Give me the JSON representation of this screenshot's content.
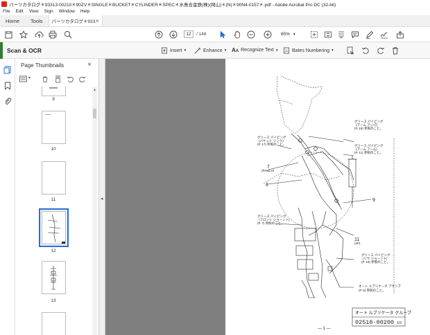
{
  "window": {
    "title": "パーツカタログ＊93313-00210＊90ZV＊SINGLE＊BUCKET＊CYLINDER＊SPEC＊水島合金鉄(株)(岡山)＊(N)＊90N4-0157＊.pdf - Adobe Acrobat Pro DC (32-bit)"
  },
  "menu": [
    "File",
    "Edit",
    "View",
    "Sign",
    "Window",
    "Help"
  ],
  "tabs": {
    "home": "Home",
    "tools": "Tools",
    "document": "パーツカタログ＊93313-...",
    "close": "×"
  },
  "toolbar": {
    "page_current": "12",
    "page_total": "/ 148",
    "zoom": "65%",
    "zoom_caret": "▾"
  },
  "scan_ocr": {
    "title": "Scan & OCR",
    "insert": "Insert",
    "enhance": "Enhance",
    "recognize": "Recognize Text",
    "bates": "Bates Numbering",
    "caret": "▾"
  },
  "thumbnails_panel": {
    "title": "Page Thumbnails",
    "close": "×",
    "collapse": "◂",
    "options_caret": "▾",
    "pages": [
      {
        "label": "9",
        "selected": false
      },
      {
        "label": "10",
        "selected": false
      },
      {
        "label": "11",
        "selected": false
      },
      {
        "label": "12",
        "selected": true
      },
      {
        "label": "13",
        "selected": false
      }
    ]
  },
  "drawing": {
    "callouts": {
      "grease_top_right_1": "グリース パイピング",
      "grease_top_right_2": "(ブーム アッパ)",
      "grease_top_right_3": "(P. 15) 参照のこと。",
      "grease_left_1": "グリース パイピング",
      "grease_left_2": "(バケット リンク)",
      "grease_left_3": "(P. 17) 参照のこと。",
      "grease_mid_right_1": "グリース パイピング",
      "grease_mid_right_2": "(ブーム アーム)",
      "grease_mid_right_3": "(P. 11) 参照のこと。",
      "grease_lower_left_1": "グリース パイピング",
      "grease_lower_left_2": "(フロント ジョーント)",
      "grease_lower_left_3": "(P. 7) 参照のこと。",
      "grease_lower_right_1": "グリース パイピング",
      "grease_lower_right_2": "(リヤ ジョーント)",
      "grease_lower_right_3": "(P. 19) 参照のこと。",
      "auto_lub_1": "オート ルブリケータ アサンブ",
      "auto_lub_2": "(P. 5) 参照のこと。",
      "num_7": "7",
      "num_7_sub": "(RH&LH)",
      "num_8": "8",
      "num_9": "9",
      "num_11": "11",
      "num_11_sub": "(2P)"
    },
    "title_block_name": "オート ルブリケータ グループ",
    "title_block_number": "02518-00200",
    "title_block_sheet": "1/3",
    "page_number": "— 1 —"
  },
  "colors": {
    "accent": "#2f7d31",
    "selection": "#2a6fd1",
    "app": "#d8261f"
  }
}
